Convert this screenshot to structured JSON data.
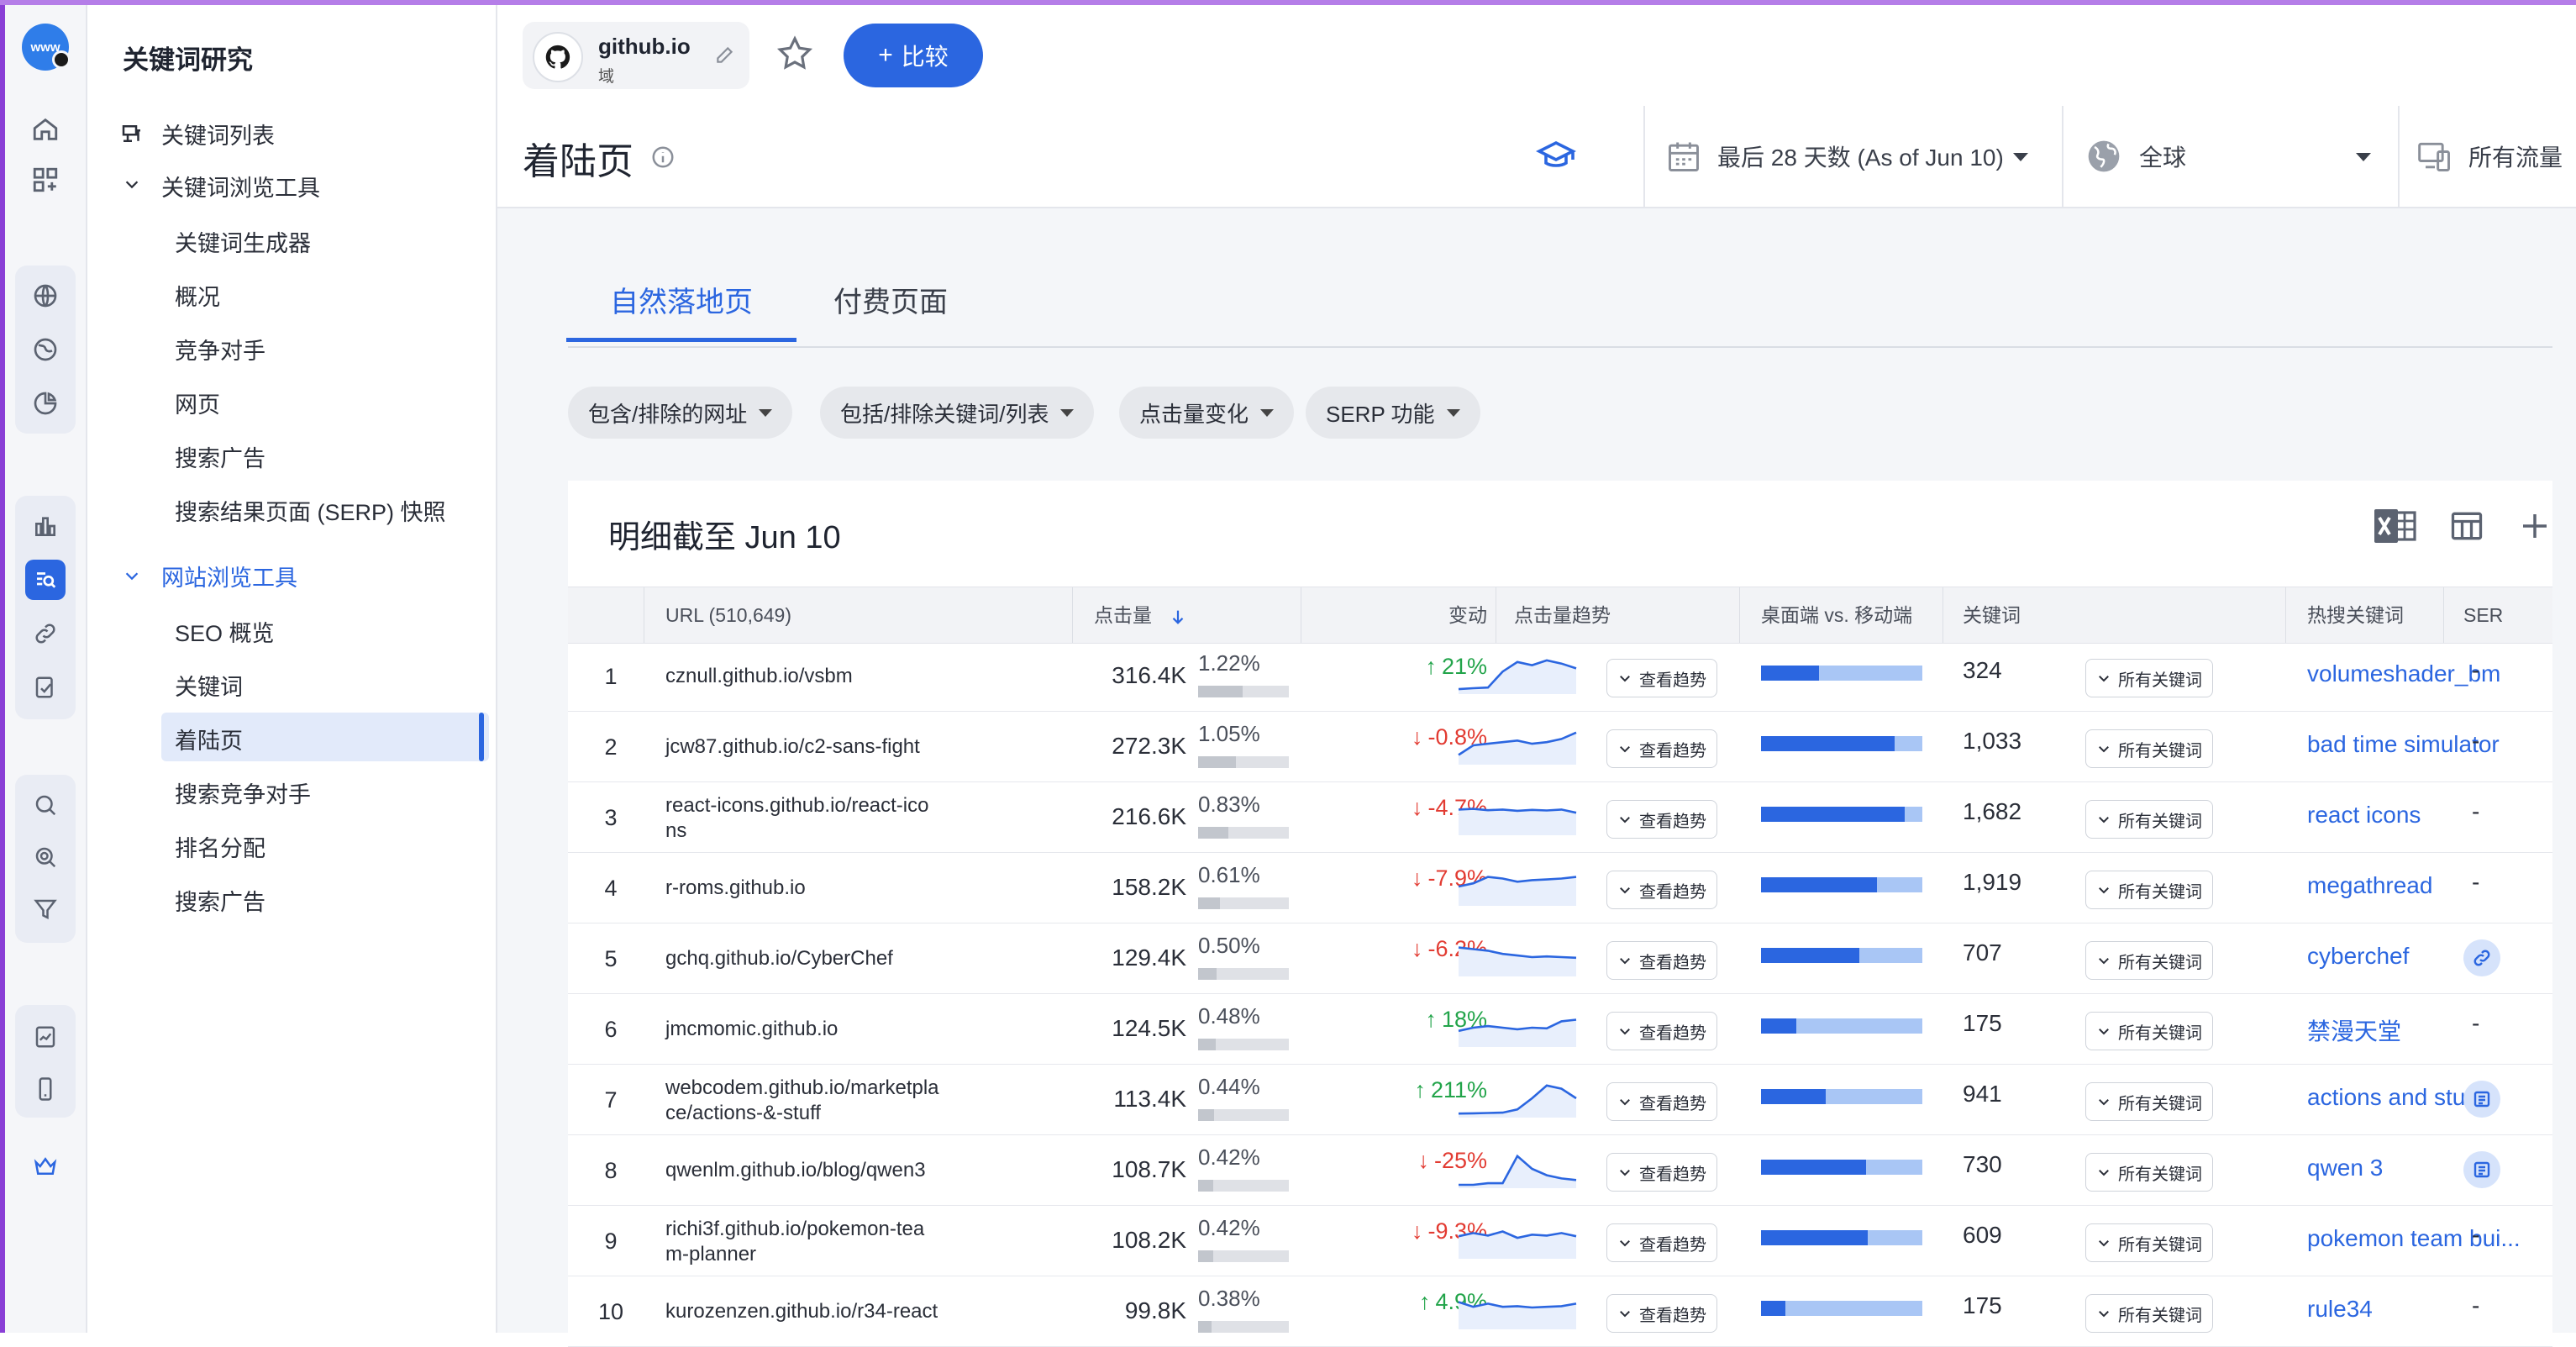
{
  "rail": {
    "logo_text": "www"
  },
  "nav": {
    "title": "关键词研究",
    "items": [
      {
        "label": "关键词列表"
      },
      {
        "label": "关键词浏览工具"
      },
      {
        "label": "关键词生成器"
      },
      {
        "label": "概况"
      },
      {
        "label": "竞争对手"
      },
      {
        "label": "网页"
      },
      {
        "label": "搜索广告"
      },
      {
        "label": "搜索结果页面 (SERP) 快照"
      },
      {
        "label": "网站浏览工具"
      },
      {
        "label": "SEO 概览"
      },
      {
        "label": "关键词"
      },
      {
        "label": "着陆页"
      },
      {
        "label": "搜索竞争对手"
      },
      {
        "label": "排名分配"
      },
      {
        "label": "搜索广告"
      }
    ]
  },
  "header": {
    "domain": "github.io",
    "domain_type": "域",
    "compare_label": "比较"
  },
  "subheader": {
    "title": "着陆页",
    "date_range": "最后 28 天数 (As of Jun 10)",
    "region": "全球",
    "traffic": "所有流量"
  },
  "tabs": [
    {
      "label": "自然落地页",
      "active": true
    },
    {
      "label": "付费页面",
      "active": false
    }
  ],
  "filters": [
    {
      "label": "包含/排除的网址"
    },
    {
      "label": "包括/排除关键词/列表"
    },
    {
      "label": "点击量变化"
    },
    {
      "label": "SERP 功能"
    }
  ],
  "table": {
    "title": "明细截至 Jun 10",
    "columns": {
      "url": "URL (510,649)",
      "clicks": "点击量",
      "change": "变动",
      "trend": "点击量趋势",
      "device": "桌面端 vs. 移动端",
      "keywords": "关键词",
      "hot": "热搜关键词",
      "serp": "SER"
    },
    "trend_button": "查看趋势",
    "keywords_button": "所有关键词",
    "rows": [
      {
        "idx": "1",
        "url": [
          "cznull.github.io/vsbm"
        ],
        "clicks": "316.4K",
        "pct": "1.22%",
        "pct_value": 1.22,
        "change": "21%",
        "dir": "up",
        "desktop_share": 0.36,
        "keywords": "324",
        "hot": "volumeshader_bm",
        "serp": "-",
        "serp_icon": "",
        "trend": [
          0.05,
          0.08,
          0.1,
          0.6,
          0.9,
          0.8,
          0.95,
          0.85,
          0.7
        ]
      },
      {
        "idx": "2",
        "url": [
          "jcw87.github.io/c2-sans-fight"
        ],
        "clicks": "272.3K",
        "pct": "1.05%",
        "pct_value": 1.05,
        "change": "-0.8%",
        "dir": "down",
        "desktop_share": 0.83,
        "keywords": "1,033",
        "hot": "bad time simulator",
        "serp": "-",
        "serp_icon": "",
        "trend": [
          0.2,
          0.5,
          0.55,
          0.6,
          0.65,
          0.55,
          0.6,
          0.7,
          0.9
        ]
      },
      {
        "idx": "3",
        "url": [
          "react-icons.github.io/react-ico",
          "ns"
        ],
        "clicks": "216.6K",
        "pct": "0.83%",
        "pct_value": 0.83,
        "change": "-4.7%",
        "dir": "down",
        "desktop_share": 0.89,
        "keywords": "1,682",
        "hot": "react icons",
        "serp": "-",
        "serp_icon": "",
        "trend": [
          0.7,
          0.72,
          0.68,
          0.7,
          0.66,
          0.69,
          0.67,
          0.7,
          0.6
        ]
      },
      {
        "idx": "4",
        "url": [
          "r-roms.github.io"
        ],
        "clicks": "158.2K",
        "pct": "0.61%",
        "pct_value": 0.61,
        "change": "-7.9%",
        "dir": "down",
        "desktop_share": 0.72,
        "keywords": "1,919",
        "hot": "megathread",
        "serp": "-",
        "serp_icon": "",
        "trend": [
          0.5,
          0.6,
          0.8,
          0.75,
          0.65,
          0.7,
          0.72,
          0.75,
          0.8
        ]
      },
      {
        "idx": "5",
        "url": [
          "gchq.github.io/CyberChef"
        ],
        "clicks": "129.4K",
        "pct": "0.50%",
        "pct_value": 0.5,
        "change": "-6.2%",
        "dir": "down",
        "desktop_share": 0.61,
        "keywords": "707",
        "hot": "cyberchef",
        "serp": "",
        "serp_icon": "link-icon",
        "trend": [
          0.8,
          0.75,
          0.7,
          0.6,
          0.55,
          0.5,
          0.52,
          0.5,
          0.48
        ]
      },
      {
        "idx": "6",
        "url": [
          "jmcmomic.github.io"
        ],
        "clicks": "124.5K",
        "pct": "0.48%",
        "pct_value": 0.48,
        "change": "18%",
        "dir": "up",
        "desktop_share": 0.22,
        "keywords": "175",
        "hot": "禁漫天堂",
        "serp": "-",
        "serp_icon": "",
        "trend": [
          0.4,
          0.5,
          0.55,
          0.5,
          0.45,
          0.5,
          0.48,
          0.7,
          0.75
        ]
      },
      {
        "idx": "7",
        "url": [
          "webcodem.github.io/marketpla",
          "ce/actions-&-stuff"
        ],
        "clicks": "113.4K",
        "pct": "0.44%",
        "pct_value": 0.44,
        "change": "211%",
        "dir": "up",
        "desktop_share": 0.4,
        "keywords": "941",
        "hot": "actions and stuff",
        "serp": "",
        "serp_icon": "list-icon",
        "trend": [
          0.02,
          0.03,
          0.04,
          0.05,
          0.15,
          0.5,
          0.9,
          0.8,
          0.5
        ]
      },
      {
        "idx": "8",
        "url": [
          "qwenlm.github.io/blog/qwen3"
        ],
        "clicks": "108.7K",
        "pct": "0.42%",
        "pct_value": 0.42,
        "change": "-25%",
        "dir": "down",
        "desktop_share": 0.65,
        "keywords": "730",
        "hot": "qwen 3",
        "serp": "",
        "serp_icon": "list-icon",
        "trend": [
          0.0,
          0.0,
          0.05,
          0.05,
          0.9,
          0.5,
          0.3,
          0.2,
          0.15
        ]
      },
      {
        "idx": "9",
        "url": [
          "richi3f.github.io/pokemon-tea",
          "m-planner"
        ],
        "clicks": "108.2K",
        "pct": "0.42%",
        "pct_value": 0.42,
        "change": "-9.3%",
        "dir": "down",
        "desktop_share": 0.66,
        "keywords": "609",
        "hot": "pokemon team bui...",
        "serp": "-",
        "serp_icon": "",
        "trend": [
          0.6,
          0.7,
          0.62,
          0.75,
          0.55,
          0.65,
          0.62,
          0.7,
          0.6
        ]
      },
      {
        "idx": "10",
        "url": [
          "kurozenzen.github.io/r34-react"
        ],
        "clicks": "99.8K",
        "pct": "0.38%",
        "pct_value": 0.38,
        "change": "4.9%",
        "dir": "up",
        "desktop_share": 0.15,
        "keywords": "175",
        "hot": "rule34",
        "serp": "-",
        "serp_icon": "",
        "trend": [
          0.75,
          0.6,
          0.7,
          0.6,
          0.62,
          0.58,
          0.6,
          0.62,
          0.7
        ]
      }
    ]
  },
  "colors": {
    "accent": "#2b66e0",
    "up": "#22a44a",
    "down": "#e23b32",
    "selected_bg": "#e2eafa"
  }
}
